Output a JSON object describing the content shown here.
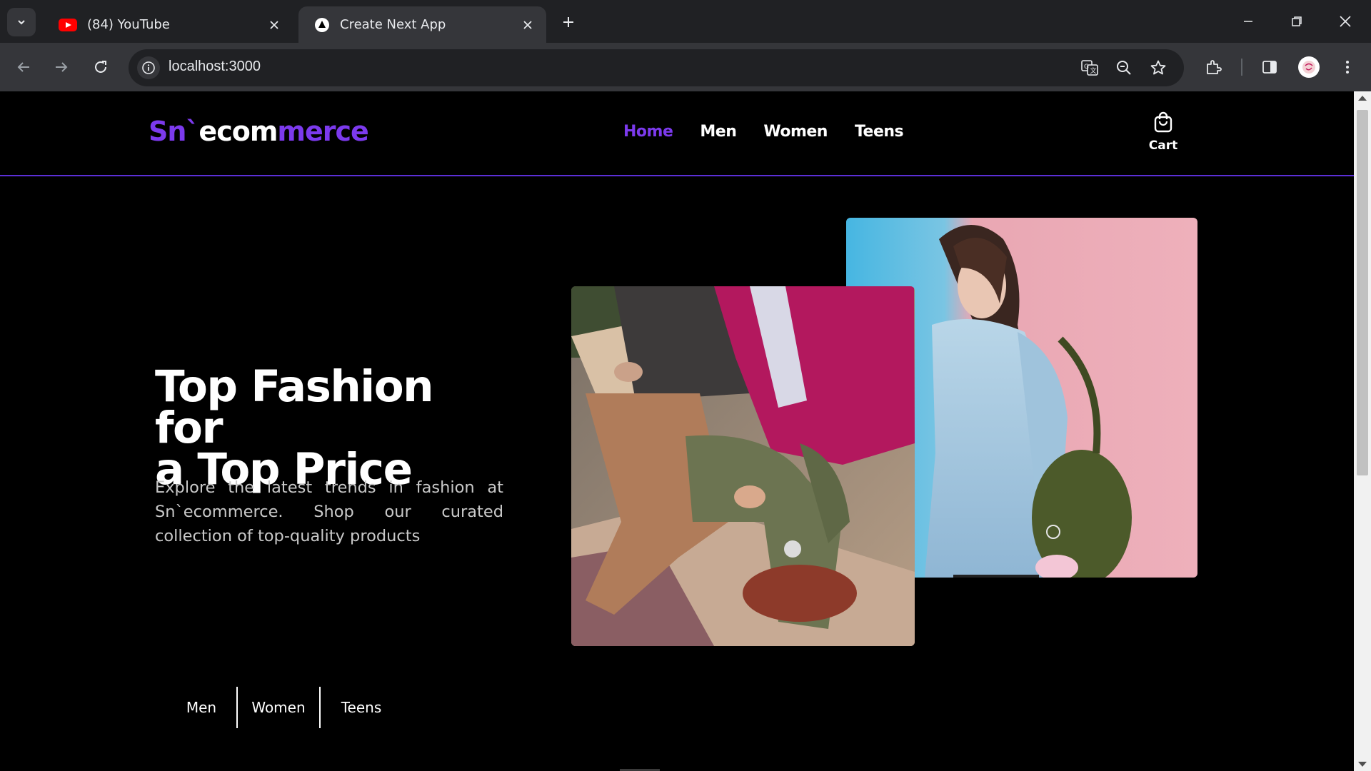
{
  "browser": {
    "tabs": [
      {
        "title": "(84) YouTube",
        "active": false,
        "icon": "youtube-icon"
      },
      {
        "title": "Create Next App",
        "active": true,
        "icon": "nextjs-icon"
      }
    ],
    "url": "localhost:3000"
  },
  "site": {
    "logo": {
      "part1": "Sn`",
      "part2": "ecom",
      "part3": "merce"
    },
    "nav": [
      {
        "label": "Home",
        "active": true
      },
      {
        "label": "Men",
        "active": false
      },
      {
        "label": "Women",
        "active": false
      },
      {
        "label": "Teens",
        "active": false
      }
    ],
    "cart_label": "Cart",
    "hero": {
      "title_line1": "Top Fashion for",
      "title_line2": "a Top Price",
      "description": "Explore the latest trends in fashion at Sn`ecommerce. Shop our curated collection of top-quality products"
    },
    "categories": [
      "Men",
      "Women",
      "Teens"
    ]
  },
  "colors": {
    "accent": "#7c3aed",
    "background": "#000000",
    "chrome_dark": "#202124",
    "chrome_mid": "#35363a"
  }
}
